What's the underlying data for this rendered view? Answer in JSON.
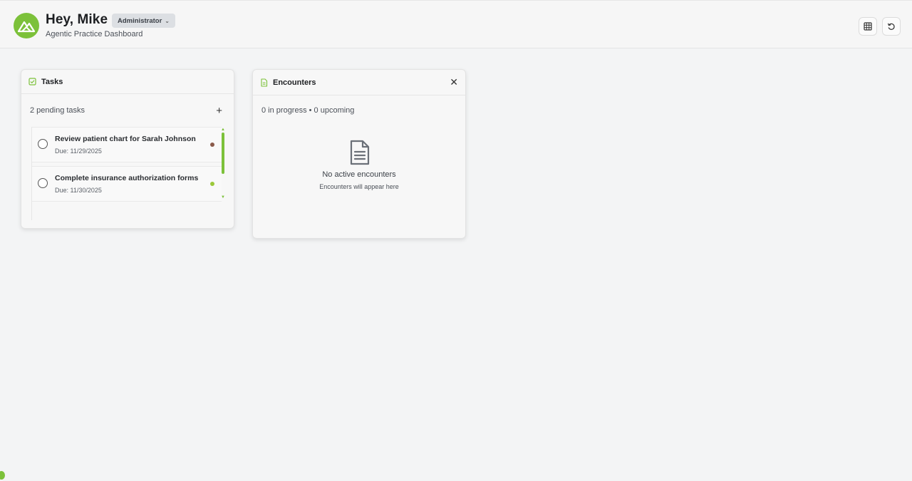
{
  "header": {
    "greeting": "Hey, Mike",
    "role": "Administrator",
    "subtitle": "Agentic Practice Dashboard",
    "actions": [
      {
        "icon": "grid-icon"
      },
      {
        "icon": "refresh-icon"
      }
    ]
  },
  "tasks_widget": {
    "title": "Tasks",
    "title_icon": "checkbox-icon",
    "pending_label": "2 pending tasks",
    "add_label": "+",
    "items": [
      {
        "title": "Review patient chart for Sarah Johnson",
        "due": "Due: 11/29/2025",
        "priority_color": "#8a5a4a"
      },
      {
        "title": "Complete insurance authorization forms",
        "due": "Due: 11/30/2025",
        "priority_color": "#9bc83a"
      }
    ]
  },
  "encounters_widget": {
    "title": "Encounters",
    "title_icon": "document-icon",
    "close_label": "✕",
    "status": "0 in progress • 0 upcoming",
    "empty_title": "No active encounters",
    "empty_subtitle": "Encounters will appear here"
  },
  "colors": {
    "accent": "#7cc13a",
    "background": "#f3f4f5",
    "role_pill": "#dcdfe3"
  }
}
